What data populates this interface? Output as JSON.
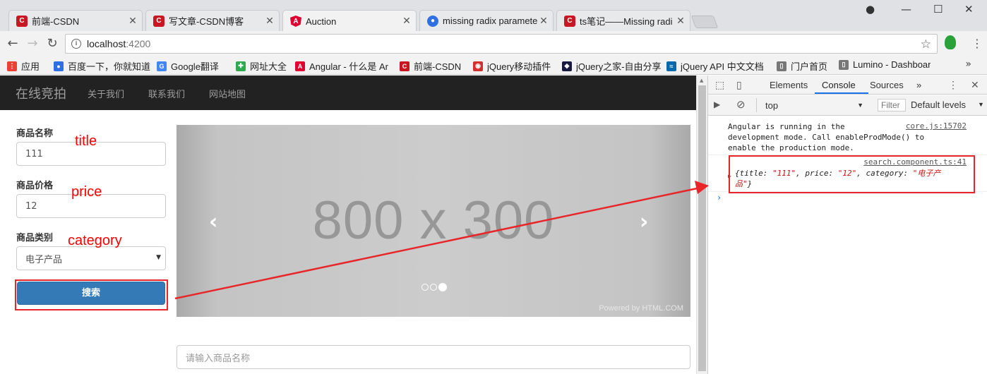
{
  "browser": {
    "tabs": [
      {
        "title": "前端-CSDN",
        "favicon": "csdn-icon",
        "color": "#c81623",
        "active": false
      },
      {
        "title": "写文章-CSDN博客",
        "favicon": "csdn-icon",
        "color": "#c81623",
        "active": false
      },
      {
        "title": "Auction",
        "favicon": "angular-icon",
        "color": "#dd0031",
        "active": true
      },
      {
        "title": "missing radix paramete",
        "favicon": "baidu-paw-icon",
        "color": "#2f6fe4",
        "active": false
      },
      {
        "title": "ts笔记——Missing radi",
        "favicon": "csdn-icon",
        "color": "#c81623",
        "active": false
      }
    ],
    "address": {
      "host": "localhost",
      "port": ":4200"
    },
    "bookmarks": [
      {
        "label": "应用",
        "icon": "apps-grid-icon",
        "color": "#e94235"
      },
      {
        "label": "百度一下，你就知道",
        "icon": "baidu-paw-icon",
        "color": "#2f6fe4"
      },
      {
        "label": "Google翻译",
        "icon": "google-translate-icon",
        "color": "#4285f4"
      },
      {
        "label": "网址大全",
        "icon": "hao123-icon",
        "color": "#2fa84f"
      },
      {
        "label": "Angular - 什么是 Ar",
        "icon": "angular-icon",
        "color": "#dd0031"
      },
      {
        "label": "前端-CSDN",
        "icon": "csdn-icon",
        "color": "#c81623"
      },
      {
        "label": "jQuery移动插件",
        "icon": "jquery-plugin-icon",
        "color": "#d32f2f"
      },
      {
        "label": "jQuery之家-自由分享",
        "icon": "jquery-home-icon",
        "color": "#1a1a40"
      },
      {
        "label": "jQuery API 中文文档",
        "icon": "jquery-icon",
        "color": "#0868ac"
      },
      {
        "label": "门户首页",
        "icon": "page-icon",
        "color": "#777777"
      },
      {
        "label": "Lumino - Dashboar",
        "icon": "page-icon",
        "color": "#777777"
      }
    ],
    "more_label": "»"
  },
  "app": {
    "brand": "在线竞拍",
    "nav": [
      "关于我们",
      "联系我们",
      "网站地图"
    ],
    "form": {
      "title_label": "商品名称",
      "title_value": "111",
      "price_label": "商品价格",
      "price_value": "12",
      "category_label": "商品类别",
      "category_value": "电子产品",
      "search_button": "搜索"
    },
    "carousel": {
      "placeholder_text": "800 x 300",
      "powered": "Powered by HTML.COM",
      "slide_count": 3,
      "active_slide": 3
    },
    "product_search_placeholder": "请输入商品名称"
  },
  "annotations": {
    "title": "title",
    "price": "price",
    "category": "category",
    "color": "#ff0000"
  },
  "devtools": {
    "tabs": [
      "Elements",
      "Console",
      "Sources"
    ],
    "active_tab": "Console",
    "more": "»",
    "context": "top",
    "filter_placeholder": "Filter",
    "levels": "Default levels",
    "log1_lines": [
      "Angular is running in the",
      "development mode. Call enableProdMode() to",
      "enable the production mode."
    ],
    "log1_src": "core.js:15702",
    "log2_src": "search.component.ts:41",
    "log2_obj": {
      "open": "{title: ",
      "title": "\"111\"",
      "mid1": ", price: ",
      "price": "\"12\"",
      "mid2": ", category: ",
      "category_a": "\"电子产",
      "category_b": "品\"",
      "close": "}"
    },
    "prompt": "›"
  }
}
